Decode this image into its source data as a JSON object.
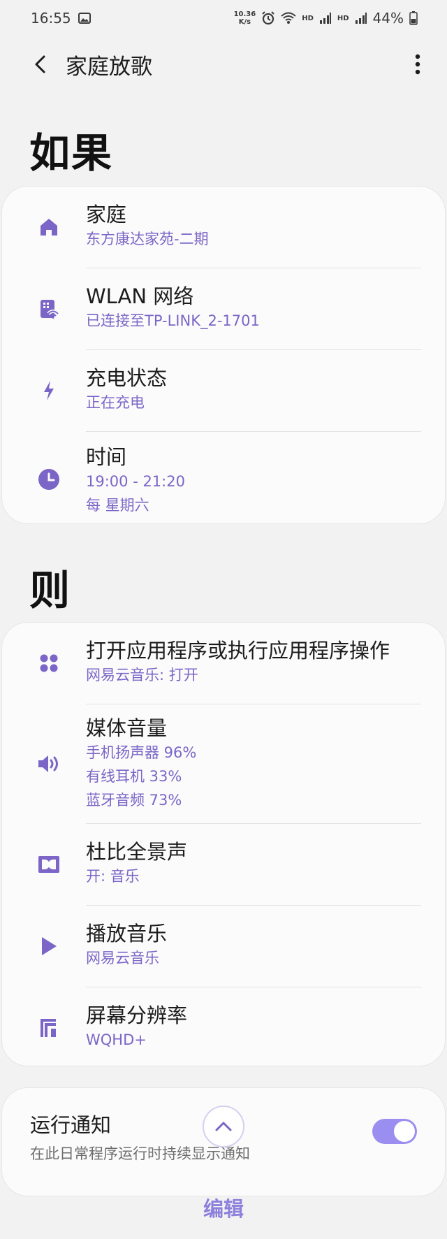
{
  "status_bar": {
    "time": "16:55",
    "net_speed_top": "10.36",
    "net_speed_bottom": "K/s",
    "hd1": "HD",
    "hd2": "HD",
    "battery": "44%"
  },
  "appbar": {
    "title": "家庭放歌"
  },
  "if_section": {
    "title": "如果",
    "rows": [
      {
        "icon": "home-icon",
        "label": "家庭",
        "subs": [
          "东方康达家苑-二期"
        ]
      },
      {
        "icon": "wlan-icon",
        "label": "WLAN 网络",
        "subs": [
          "已连接至TP-LINK_2-1701"
        ]
      },
      {
        "icon": "charging-icon",
        "label": "充电状态",
        "subs": [
          "正在充电"
        ]
      },
      {
        "icon": "clock-icon",
        "label": "时间",
        "subs": [
          "19:00 - 21:20",
          "每 星期六"
        ]
      }
    ]
  },
  "then_section": {
    "title": "则",
    "rows": [
      {
        "icon": "apps-icon",
        "label": "打开应用程序或执行应用程序操作",
        "subs": [
          "网易云音乐: 打开"
        ]
      },
      {
        "icon": "volume-icon",
        "label": "媒体音量",
        "subs": [
          "手机扬声器 96%",
          "有线耳机 33%",
          "蓝牙音频 73%"
        ]
      },
      {
        "icon": "dolby-icon",
        "label": "杜比全景声",
        "subs": [
          "开: 音乐"
        ]
      },
      {
        "icon": "play-icon",
        "label": "播放音乐",
        "subs": [
          "网易云音乐"
        ]
      },
      {
        "icon": "resolution-icon",
        "label": "屏幕分辨率",
        "subs": [
          "WQHD+"
        ]
      }
    ]
  },
  "notification": {
    "title": "运行通知",
    "subtitle": "在此日常程序运行时持续显示通知",
    "enabled": true
  },
  "edit_label": "编辑",
  "colors": {
    "accent": "#7b66c7",
    "toggle": "#9a8ef0",
    "edit": "#8d7fdc"
  }
}
